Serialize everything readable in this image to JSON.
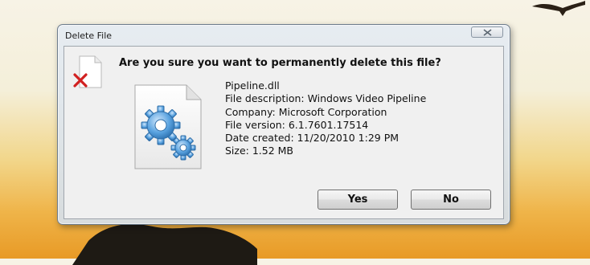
{
  "window": {
    "title": "Delete File"
  },
  "dialog": {
    "question": "Are you sure you want to permanently delete this file?",
    "file": {
      "name": "Pipeline.dll",
      "description": "File description: Windows Video Pipeline",
      "company": "Company: Microsoft Corporation",
      "version": "File version: 6.1.7601.17514",
      "date_created": "Date created: 11/20/2010 1:29 PM",
      "size": "Size: 1.52 MB"
    },
    "buttons": {
      "yes": "Yes",
      "no": "No"
    }
  },
  "icons": {
    "close": "close-icon",
    "delete_file": "delete-file-icon",
    "dll_file": "dll-file-icon"
  },
  "colors": {
    "delete_x": "#d12020",
    "gear": "#3f8fd6"
  }
}
